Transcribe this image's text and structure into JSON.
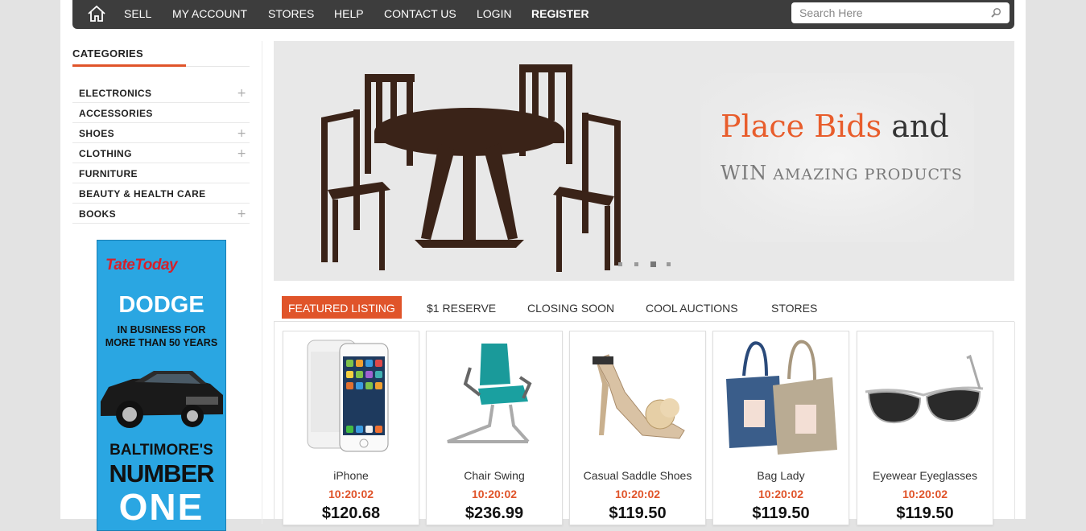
{
  "nav": {
    "links": [
      "SELL",
      "MY ACCOUNT",
      "STORES",
      "HELP",
      "CONTACT US",
      "LOGIN",
      "REGISTER"
    ],
    "home_icon": "home-icon",
    "search": {
      "placeholder": "Search Here",
      "value": "",
      "icon": "search-icon"
    }
  },
  "sidebar": {
    "title": "CATEGORIES",
    "categories": [
      {
        "label": "ELECTRONICS",
        "expandable": true
      },
      {
        "label": "ACCESSORIES",
        "expandable": false
      },
      {
        "label": "SHOES",
        "expandable": true
      },
      {
        "label": "CLOTHING",
        "expandable": true
      },
      {
        "label": "FURNITURE",
        "expandable": false
      },
      {
        "label": "BEAUTY & HEALTH CARE",
        "expandable": false
      },
      {
        "label": "BOOKS",
        "expandable": true
      }
    ],
    "expand_symbol": "+",
    "ad": {
      "brand": "TateToday",
      "headline": "DODGE",
      "tagline_1": "IN BUSINESS FOR",
      "tagline_2": "MORE THAN 50 YEARS",
      "city": "BALTIMORE'S",
      "number": "NUMBER",
      "one": "ONE"
    }
  },
  "banner": {
    "heading_orange": "Place Bids",
    "heading_dark": " and",
    "subheading_big": "WIN",
    "subheading_small": " AMAZING PRODUCTS",
    "slides": 4,
    "active_slide": 3
  },
  "tabs": [
    "FEATURED LISTING",
    "$1 RESERVE",
    "CLOSING SOON",
    "COOL AUCTIONS",
    "STORES"
  ],
  "active_tab": 0,
  "products": [
    {
      "name": "iPhone",
      "time": "10:20:02",
      "price": "$120.68"
    },
    {
      "name": "Chair Swing",
      "time": "10:20:02",
      "price": "$236.99"
    },
    {
      "name": "Casual Saddle Shoes",
      "time": "10:20:02",
      "price": "$119.50"
    },
    {
      "name": "Bag Lady",
      "time": "10:20:02",
      "price": "$119.50"
    },
    {
      "name": "Eyewear Eyeglasses",
      "time": "10:20:02",
      "price": "$119.50"
    }
  ],
  "colors": {
    "accent": "#e0542a",
    "nav_bg": "#3d3d3d",
    "ad_bg": "#2aa6e2"
  }
}
